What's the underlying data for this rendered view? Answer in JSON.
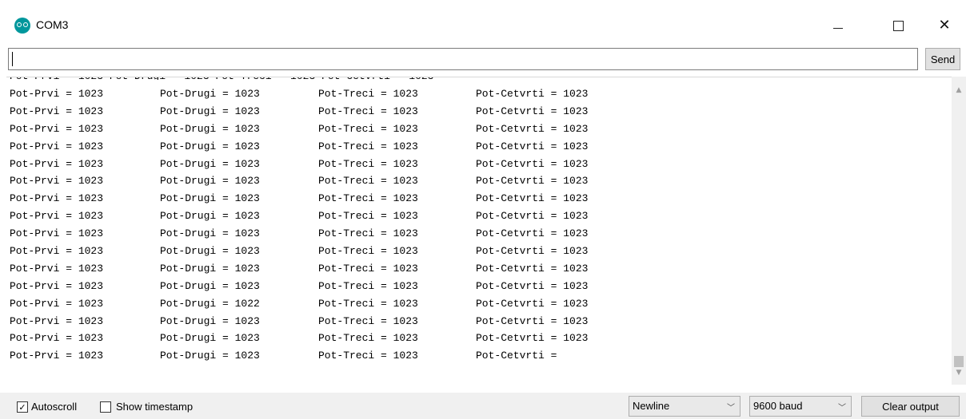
{
  "window": {
    "title": "COM3",
    "minimize_icon": "minimize-icon",
    "maximize_icon": "maximize-icon",
    "close_glyph": "✕"
  },
  "input": {
    "value": "",
    "send_label": "Send"
  },
  "output": {
    "labels": {
      "prvi": "Pot-Prvi = ",
      "drugi": "Pot-Drugi = ",
      "treci": "Pot-Treci = ",
      "cetvrti": "Pot-Cetvrti = "
    },
    "lines": [
      [
        "1023",
        "1023",
        "1023",
        "1023"
      ],
      [
        "1023",
        "1023",
        "1023",
        "1023"
      ],
      [
        "1023",
        "1023",
        "1023",
        "1023"
      ],
      [
        "1023",
        "1023",
        "1023",
        "1023"
      ],
      [
        "1023",
        "1023",
        "1023",
        "1023"
      ],
      [
        "1023",
        "1023",
        "1023",
        "1023"
      ],
      [
        "1023",
        "1023",
        "1023",
        "1023"
      ],
      [
        "1023",
        "1023",
        "1023",
        "1023"
      ],
      [
        "1023",
        "1023",
        "1023",
        "1023"
      ],
      [
        "1023",
        "1023",
        "1023",
        "1023"
      ],
      [
        "1023",
        "1023",
        "1023",
        "1023"
      ],
      [
        "1023",
        "1023",
        "1023",
        "1023"
      ],
      [
        "1023",
        "1022",
        "1023",
        "1023"
      ],
      [
        "1023",
        "1023",
        "1023",
        "1023"
      ],
      [
        "1023",
        "1023",
        "1023",
        "1023"
      ],
      [
        "1023",
        "1023",
        "1023",
        ""
      ]
    ]
  },
  "bottom": {
    "autoscroll_label": "Autoscroll",
    "autoscroll_checked": true,
    "timestamp_label": "Show timestamp",
    "timestamp_checked": false,
    "line_ending": "Newline",
    "baud": "9600 baud",
    "clear_label": "Clear output",
    "dropdown_icon": "chevron-down-icon"
  }
}
